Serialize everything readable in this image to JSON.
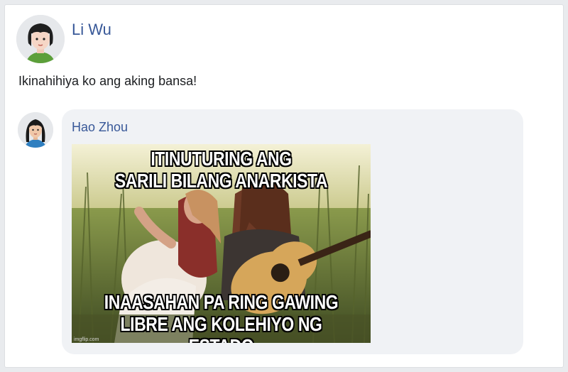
{
  "post": {
    "author": "Li Wu",
    "text": "Ikinahihiya ko ang aking bansa!"
  },
  "comment": {
    "author": "Hao Zhou",
    "meme": {
      "top_text": "ITINUTURING ANG\nSARILI BILANG ANARKISTA",
      "bottom_text": "INAASAHAN PA RING GAWING\nLIBRE ANG KOLEHIYO NG ESTADO",
      "watermark": "imgflip.com"
    }
  },
  "colors": {
    "link": "#385898",
    "text": "#1c1e21",
    "bubble": "#f0f2f5",
    "background": "#e9ebee"
  },
  "icons": {
    "post_avatar": "woman-avatar-icon",
    "comment_avatar": "woman-avatar-icon"
  }
}
